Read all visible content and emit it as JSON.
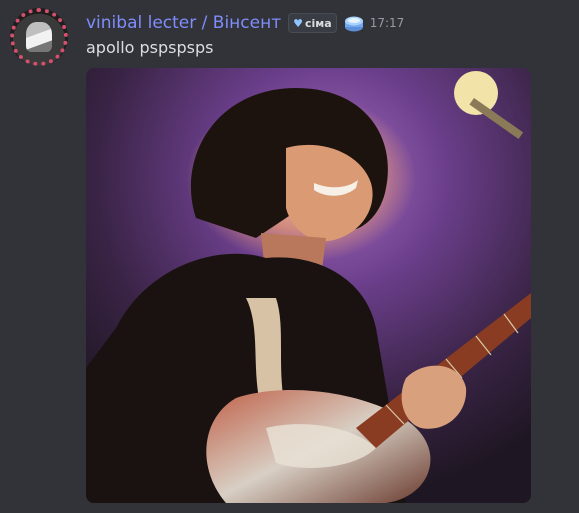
{
  "message": {
    "author": "vinibal lecter / Вінсент",
    "clan_tag": "сіма",
    "clan_tag_icon": "blue-heart-icon",
    "role_icon": "blue-cake-icon",
    "timestamp": "17:17",
    "text": "apollo pspspsps"
  },
  "attachment": {
    "type": "image",
    "subject": "guitarist-concert-photo"
  },
  "colors": {
    "background": "#313338",
    "username": "#7f8dfd",
    "text": "#dbdee1",
    "timestamp": "#949ba4"
  }
}
